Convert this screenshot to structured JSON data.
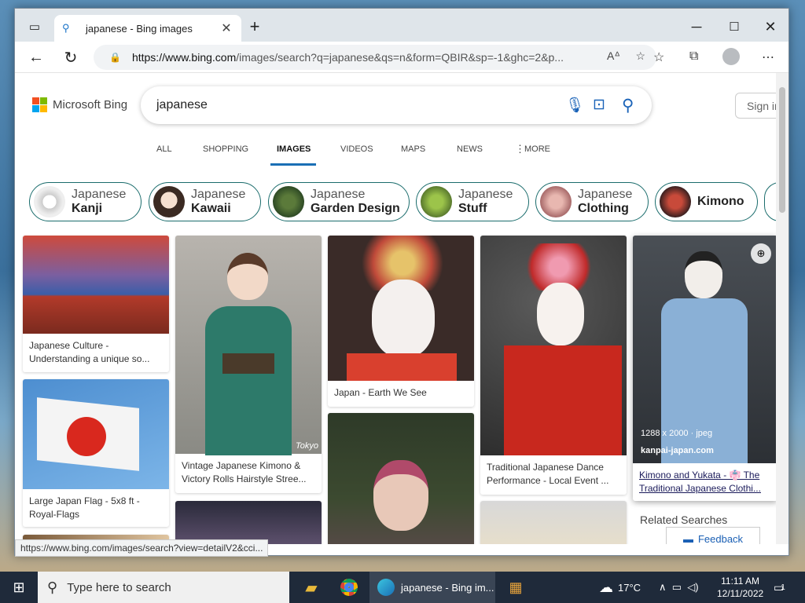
{
  "browser": {
    "tab_title": "japanese - Bing images",
    "url_host": "https://www.bing.com",
    "url_rest": "/images/search?q=japanese&qs=n&form=QBIR&sp=-1&ghc=2&p...",
    "status_url": "https://www.bing.com/images/search?view=detailV2&cci..."
  },
  "bing": {
    "logo_text": "Microsoft Bing",
    "query": "japanese",
    "signin": "Sign in",
    "scopes": [
      "ALL",
      "SHOPPING",
      "IMAGES",
      "VIDEOS",
      "MAPS",
      "NEWS",
      "MORE"
    ],
    "active_scope": "IMAGES",
    "chips": [
      {
        "top": "Japanese",
        "bottom": "Kanji"
      },
      {
        "top": "Japanese",
        "bottom": "Kawaii"
      },
      {
        "top": "Japanese",
        "bottom": "Garden Design"
      },
      {
        "top": "Japanese",
        "bottom": "Stuff"
      },
      {
        "top": "Japanese",
        "bottom": "Clothing"
      },
      {
        "top": "",
        "bottom": "Kimono"
      }
    ],
    "results": [
      {
        "caption": "Japanese Culture - Understanding a unique so..."
      },
      {
        "caption": "Large Japan Flag - 5x8 ft - Royal-Flags"
      },
      {
        "caption": "Vintage Japanese Kimono & Victory Rolls Hairstyle Stree..."
      },
      {
        "caption": "Japan - Earth We See"
      },
      {
        "caption": "Traditional Japanese Dance Performance - Local Event ..."
      },
      {
        "caption": "Kimono and Yukata - 👘 The Traditional Japanese Clothi..."
      }
    ],
    "hover_meta": "1288 x 2000 · jpeg",
    "hover_source": "kanpai-japan.com",
    "watermark": "Tokyo",
    "related_searches": "Related Searches",
    "feedback": "Feedback"
  },
  "taskbar": {
    "search_placeholder": "Type here to search",
    "edge_label": "japanese - Bing im...",
    "weather": "17°C",
    "time": "11:11 AM",
    "date": "12/11/2022",
    "notifications": "1"
  }
}
